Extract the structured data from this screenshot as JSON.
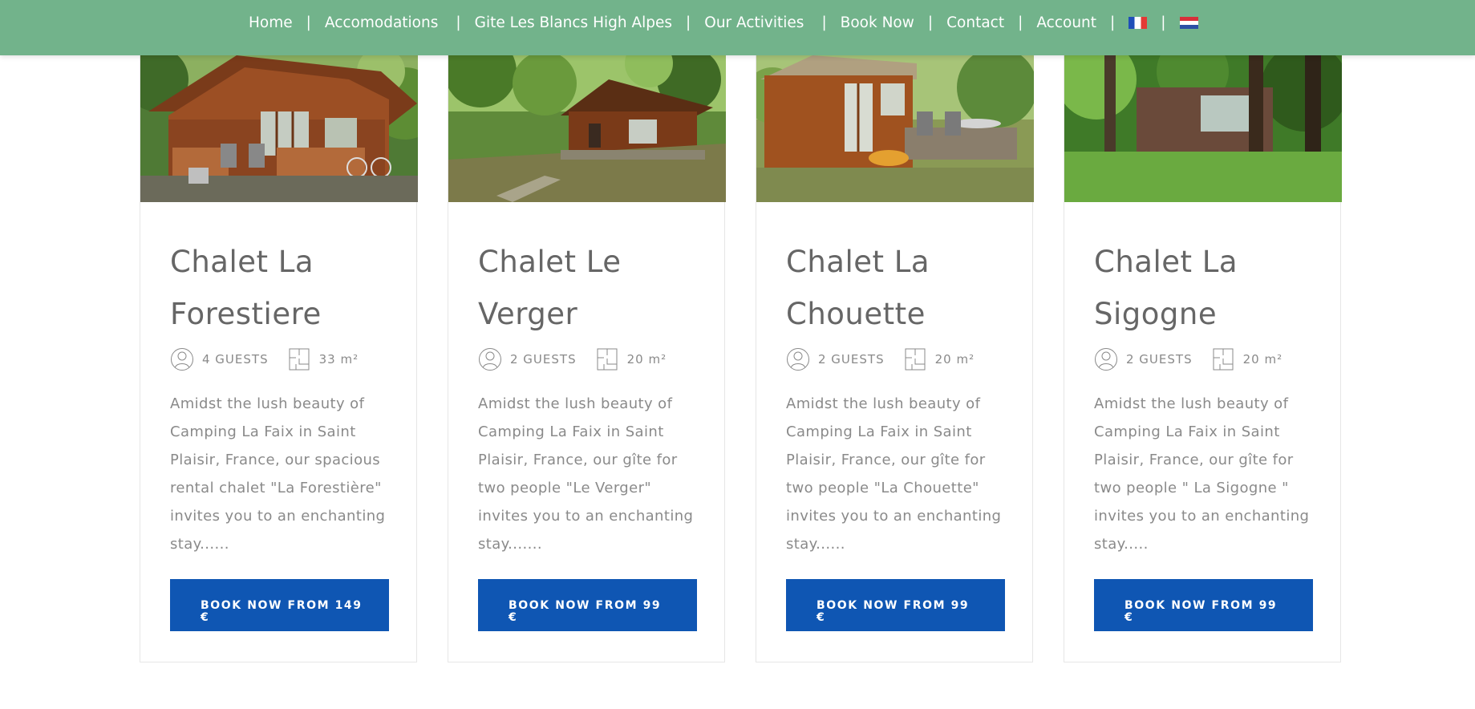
{
  "nav": {
    "items": [
      {
        "label": "Home"
      },
      {
        "label": "Accomodations"
      },
      {
        "label": "Gite Les Blancs High Alpes"
      },
      {
        "label": "Our Activities"
      },
      {
        "label": "Book Now"
      },
      {
        "label": "Contact"
      },
      {
        "label": "Account"
      }
    ],
    "separator": "|",
    "flags": [
      "flag-france-icon",
      "flag-netherlands-icon"
    ]
  },
  "colors": {
    "header_bg": "#72b38b",
    "button_bg": "#0f56b3",
    "text": "#666666"
  },
  "cards": [
    {
      "title": "Chalet La Forestiere",
      "guests": "4 GUESTS",
      "area": "33 m²",
      "description": "Amidst the lush beauty of Camping La Faix in Saint Plaisir, France, our spacious rental chalet \"La Forestière\" invites you to an enchanting stay......",
      "button": "BOOK NOW FROM 149 €"
    },
    {
      "title": "Chalet Le Verger",
      "guests": "2 GUESTS",
      "area": "20 m²",
      "description": "Amidst the lush beauty of Camping La Faix in Saint Plaisir, France, our gîte for two people \"Le Verger\" invites you to an enchanting stay.......",
      "button": "BOOK NOW FROM 99 €"
    },
    {
      "title": "Chalet La Chouette",
      "guests": "2 GUESTS",
      "area": "20 m²",
      "description": "Amidst the lush beauty of Camping La Faix in Saint Plaisir, France, our gîte for two people \"La Chouette\" invites you to an enchanting stay......",
      "button": "BOOK NOW FROM 99 €"
    },
    {
      "title": "Chalet La Sigogne",
      "guests": "2 GUESTS",
      "area": "20 m²",
      "description": "Amidst the lush beauty of Camping La Faix in Saint Plaisir, France, our gîte for two people \" La Sigogne \" invites you to an enchanting stay.....",
      "button": "BOOK NOW FROM 99 €"
    }
  ]
}
